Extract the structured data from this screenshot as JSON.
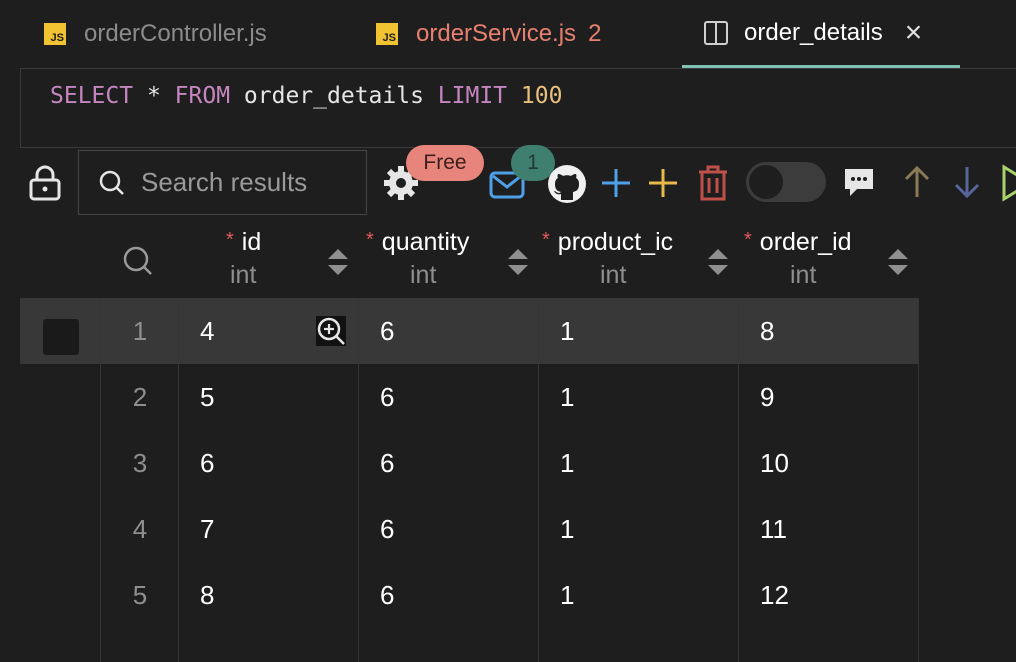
{
  "tabs": [
    {
      "badge": "JS",
      "label": "orderController.js"
    },
    {
      "badge": "JS",
      "label": "orderService.js",
      "count": "2"
    },
    {
      "label": "order_details",
      "close": "×"
    }
  ],
  "query": {
    "kw1": "SELECT",
    "star": "*",
    "kw2": "FROM",
    "table": "order_details",
    "kw3": "LIMIT",
    "limit": "100"
  },
  "toolbar": {
    "search_placeholder": "Search results",
    "free_badge": "Free",
    "mail_count": "1"
  },
  "columns": [
    {
      "name": "id",
      "type": "int",
      "required": "*"
    },
    {
      "name": "quantity",
      "type": "int",
      "required": "*"
    },
    {
      "name": "product_ic",
      "type": "int",
      "required": "*"
    },
    {
      "name": "order_id",
      "type": "int",
      "required": "*"
    }
  ],
  "rows": [
    {
      "num": "1",
      "id": "4",
      "quantity": "6",
      "product_id": "1",
      "order_id": "8"
    },
    {
      "num": "2",
      "id": "5",
      "quantity": "6",
      "product_id": "1",
      "order_id": "9"
    },
    {
      "num": "3",
      "id": "6",
      "quantity": "6",
      "product_id": "1",
      "order_id": "10"
    },
    {
      "num": "4",
      "id": "7",
      "quantity": "6",
      "product_id": "1",
      "order_id": "11"
    },
    {
      "num": "5",
      "id": "8",
      "quantity": "6",
      "product_id": "1",
      "order_id": "12"
    }
  ],
  "colors": {
    "accent": "#7fc3b4",
    "keyword": "#c586c0",
    "number": "#e8c07d",
    "error": "#e8806f"
  }
}
